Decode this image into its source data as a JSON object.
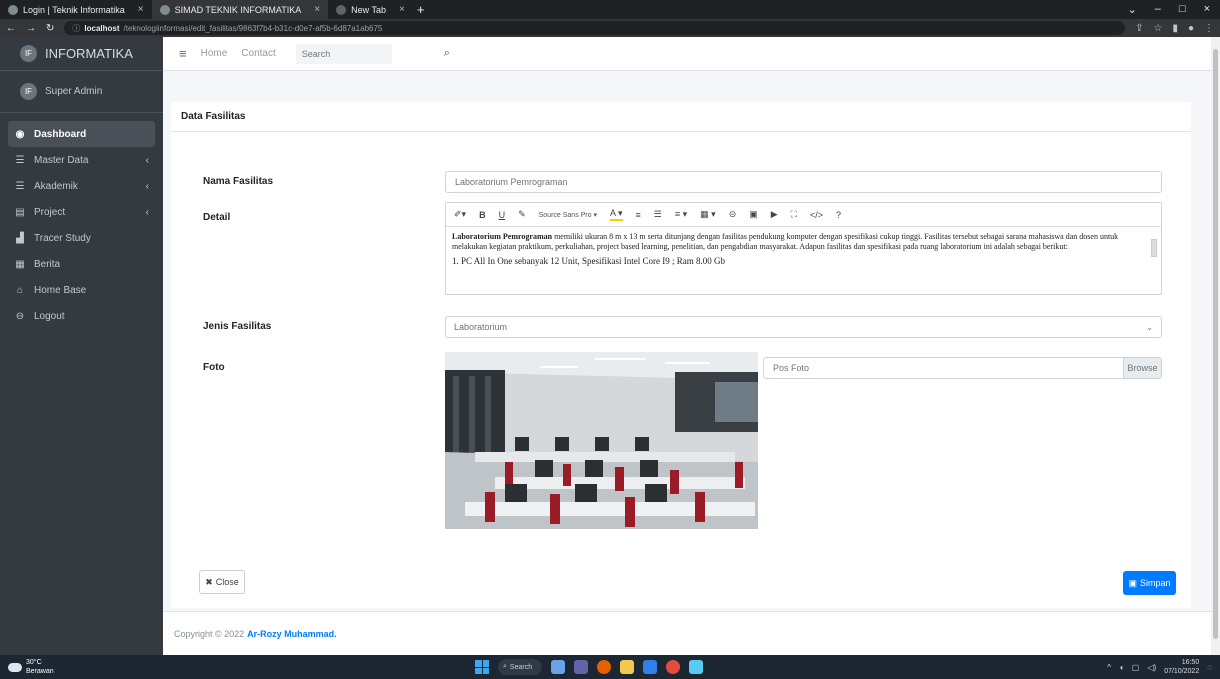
{
  "browser": {
    "tabs": [
      {
        "title": "Login | Teknik Informatika",
        "close": "×"
      },
      {
        "title": "SIMAD TEKNIK INFORMATIKA",
        "close": "×"
      },
      {
        "title": "New Tab",
        "close": "×"
      }
    ],
    "new_tab": "+",
    "url_host": "localhost",
    "url_path": "/teknologiinformasi/edit_fasilitas/9863f7b4-b31c-d0e7-af5b-6d87a1ab675",
    "window_controls": [
      "⌄",
      "–",
      "□",
      "×"
    ]
  },
  "sidebar": {
    "brand_logo": "IF",
    "brand": "INFORMATIKA",
    "user_logo": "IF",
    "user": "Super Admin",
    "items": [
      {
        "label": "Dashboard",
        "icon": "palette-icon",
        "glyph": "◉",
        "active": true,
        "arrow": ""
      },
      {
        "label": "Master Data",
        "icon": "list-icon",
        "glyph": "☰",
        "active": false,
        "arrow": "‹"
      },
      {
        "label": "Akademik",
        "icon": "list-icon",
        "glyph": "☰",
        "active": false,
        "arrow": "‹"
      },
      {
        "label": "Project",
        "icon": "database-icon",
        "glyph": "▤",
        "active": false,
        "arrow": "‹"
      },
      {
        "label": "Tracer Study",
        "icon": "chart-icon",
        "glyph": "▟",
        "active": false,
        "arrow": ""
      },
      {
        "label": "Berita",
        "icon": "newspaper-icon",
        "glyph": "▦",
        "active": false,
        "arrow": ""
      },
      {
        "label": "Home Base",
        "icon": "home-icon",
        "glyph": "⌂",
        "active": false,
        "arrow": ""
      },
      {
        "label": "Logout",
        "icon": "logout-icon",
        "glyph": "⊖",
        "active": false,
        "arrow": ""
      }
    ]
  },
  "topbar": {
    "menu_icon": "≡",
    "home": "Home",
    "contact": "Contact",
    "search_placeholder": "Search",
    "search_icon": "⌕"
  },
  "card": {
    "title": "Data Fasilitas",
    "labels": {
      "nama": "Nama Fasilitas",
      "detail": "Detail",
      "jenis": "Jenis Fasilitas",
      "foto": "Foto"
    },
    "nama_value": "Laboratorium Pemrograman",
    "editor": {
      "toolbar": [
        "✐▾",
        "B",
        "U",
        "✎",
        "Source Sans Pro ▾",
        "A ▾",
        "≡",
        "☰",
        "≡ ▾",
        "▦ ▾",
        "⊝",
        "▣",
        "▶",
        "⛶",
        "</>",
        "?"
      ],
      "bold_lead": "Laboratorium Pemrograman",
      "text": " memiliki ukuran 8 m x 13 m serta ditunjang dengan fasilitas pendukung komputer dengan spesifikasi cukup tinggi. Fasilitas tersebut sebagai sarana mahasiswa dan dosen untuk melakukan kegiatan praktikum, perkuliahan, project based learning, penelitian, dan pengabdian masyarakat. Adapun fasilitas dan spesifikasi pada ruang laboratorium ini adalah sebagai berikut:",
      "list_item": "1.  PC All In One sebanyak 12 Unit, Spesifikasi Intel Core I9 ; Ram 8.00 Gb"
    },
    "jenis_value": "Laboratorium",
    "file_placeholder": "Pos Foto",
    "browse": "Browse",
    "close_icon": "✖",
    "close": "Close",
    "save_icon": "▣",
    "save": "Simpan"
  },
  "footer": {
    "text": "Copyright © 2022",
    "author": "Ar-Rozy Muhammad."
  },
  "taskbar": {
    "temp": "30°C",
    "weather": "Berawan",
    "search": "Search",
    "time": "16:50",
    "date": "07/10/2022"
  }
}
